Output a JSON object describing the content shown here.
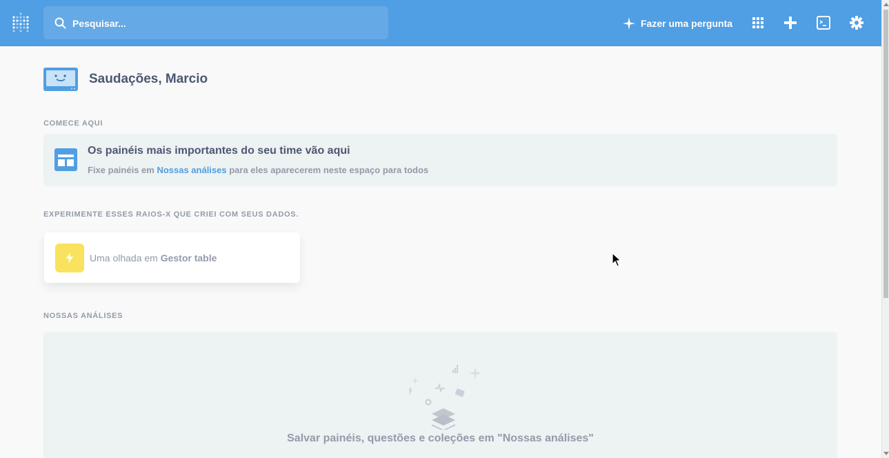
{
  "nav": {
    "search_placeholder": "Pesquisar...",
    "ask_label": "Fazer uma pergunta",
    "brand_color": "#509ee3"
  },
  "greeting": "Saudações, Marcio",
  "start": {
    "section_title": "COMECE AQUI",
    "card_title": "Os painéis mais importantes do seu time vão aqui",
    "desc_before": "Fixe painéis em ",
    "desc_link": "Nossas análises",
    "desc_after": " para eles aparecerem neste espaço para todos"
  },
  "xray": {
    "section_title": "EXPERIMENTE ESSES RAIOS-X QUE CRIEI COM SEUS DADOS.",
    "card_prefix": "Uma olhada em ",
    "card_table": "Gestor table"
  },
  "collection": {
    "section_title": "NOSSAS ANÁLISES",
    "empty_text": "Salvar painéis, questões e coleções em \"Nossas análises\""
  },
  "icons": {
    "logo": "metabase-logo-icon",
    "search": "search-icon",
    "ask": "sparkle-icon",
    "grid": "grid-icon",
    "add": "plus-icon",
    "sql": "terminal-icon",
    "settings": "gear-icon"
  }
}
